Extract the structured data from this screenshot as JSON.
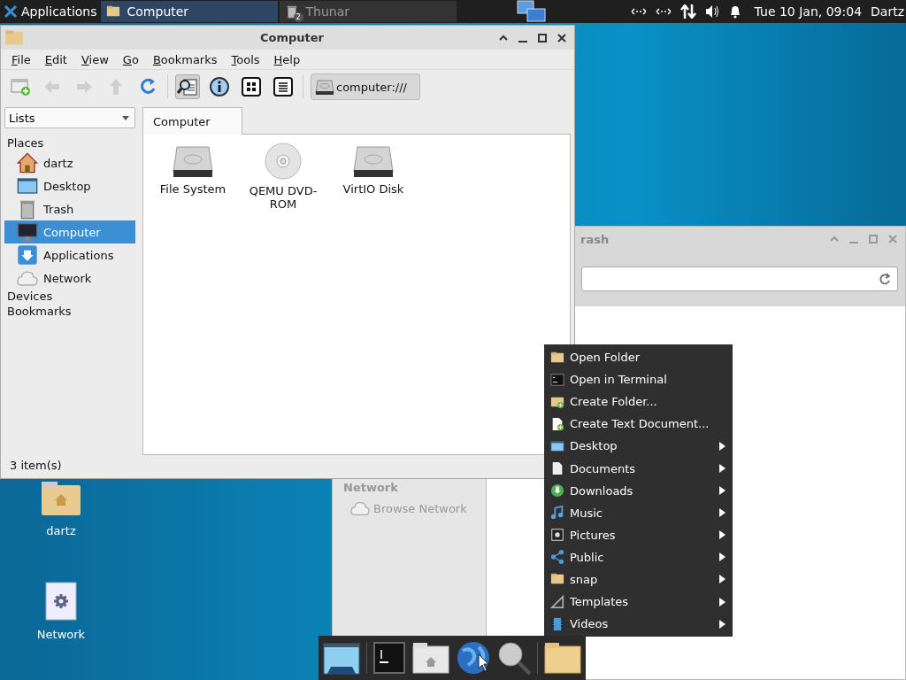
{
  "top_panel": {
    "apps_menu": "Applications",
    "tasks": [
      {
        "label": "Computer",
        "kind": "folder",
        "selected": true
      },
      {
        "label": "Thunar",
        "kind": "trash",
        "badge": "2",
        "selected": false
      }
    ],
    "clock": "Tue 10 Jan, 09:04",
    "user": "Dartz"
  },
  "trash_window": {
    "title": "rash",
    "sidebar_heading": "Network",
    "sidebar_items": [
      {
        "label": "Browse Network"
      }
    ]
  },
  "computer_window": {
    "title": "Computer",
    "menu": [
      "File",
      "Edit",
      "View",
      "Go",
      "Bookmarks",
      "Tools",
      "Help"
    ],
    "nav_buttons": [
      {
        "kind": "new-window",
        "disabled": false
      },
      {
        "kind": "back",
        "disabled": true
      },
      {
        "kind": "forward",
        "disabled": true
      },
      {
        "kind": "up",
        "disabled": true
      },
      {
        "kind": "reload",
        "disabled": false
      }
    ],
    "view_buttons": [
      {
        "kind": "find",
        "selected": true
      },
      {
        "kind": "info",
        "selected": false
      },
      {
        "kind": "icons",
        "selected": false
      },
      {
        "kind": "list",
        "selected": false
      }
    ],
    "location": "computer:///",
    "side_pane_selector": "Lists",
    "tabs": [
      {
        "label": "Computer",
        "selected": true
      }
    ],
    "sidebar": {
      "heading": "Places",
      "items": [
        {
          "label": "dartz",
          "kind": "home",
          "selected": false
        },
        {
          "label": "Desktop",
          "kind": "desktop",
          "selected": false
        },
        {
          "label": "Trash",
          "kind": "trash",
          "selected": false
        },
        {
          "label": "Computer",
          "kind": "computer",
          "selected": true
        },
        {
          "label": "Applications",
          "kind": "applications",
          "selected": false
        },
        {
          "label": "Network",
          "kind": "network",
          "selected": false
        }
      ],
      "sections": [
        "Devices",
        "Bookmarks"
      ]
    },
    "items": [
      {
        "label": "File System",
        "kind": "drive"
      },
      {
        "label": "QEMU DVD-ROM",
        "kind": "disc"
      },
      {
        "label": "VirtIO Disk",
        "kind": "drive"
      }
    ],
    "status_bar": "3 item(s)"
  },
  "context_menu": {
    "items": [
      {
        "label": "Open Folder",
        "kind": "folder",
        "submenu": false
      },
      {
        "label": "Open in Terminal",
        "kind": "terminal",
        "submenu": false
      },
      {
        "label": "Create Folder...",
        "kind": "new-folder",
        "submenu": false
      },
      {
        "label": "Create Text Document...",
        "kind": "new-document",
        "submenu": false
      },
      {
        "label": "Desktop",
        "kind": "desktop",
        "submenu": true
      },
      {
        "label": "Documents",
        "kind": "document",
        "submenu": true
      },
      {
        "label": "Downloads",
        "kind": "download",
        "submenu": true
      },
      {
        "label": "Music",
        "kind": "music",
        "submenu": true
      },
      {
        "label": "Pictures",
        "kind": "picture",
        "submenu": true
      },
      {
        "label": "Public",
        "kind": "share",
        "submenu": true
      },
      {
        "label": "snap",
        "kind": "folder",
        "submenu": true
      },
      {
        "label": "Templates",
        "kind": "template",
        "submenu": true
      },
      {
        "label": "Videos",
        "kind": "video",
        "submenu": true
      }
    ]
  },
  "desktop_icons": [
    {
      "label": "dartz",
      "kind": "home"
    },
    {
      "label": "Network",
      "kind": "settings"
    }
  ]
}
